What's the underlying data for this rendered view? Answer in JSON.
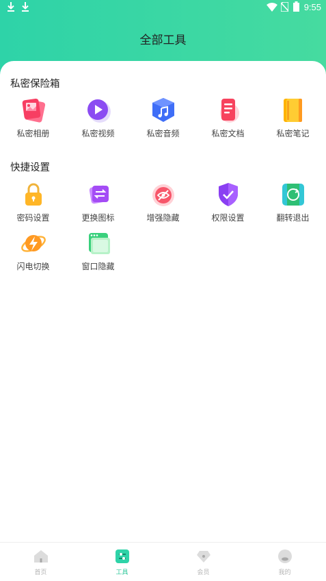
{
  "status_bar": {
    "time": "9:55",
    "icons": [
      "download-icon",
      "download-icon",
      "wifi-icon",
      "no-sim-icon",
      "battery-icon"
    ]
  },
  "header": {
    "title": "全部工具"
  },
  "sections": [
    {
      "title": "私密保险箱",
      "items": [
        {
          "label": "私密相册",
          "icon": "photo-album-icon"
        },
        {
          "label": "私密视频",
          "icon": "video-icon"
        },
        {
          "label": "私密音频",
          "icon": "audio-icon"
        },
        {
          "label": "私密文档",
          "icon": "document-icon"
        },
        {
          "label": "私密笔记",
          "icon": "notebook-icon"
        }
      ]
    },
    {
      "title": "快捷设置",
      "items": [
        {
          "label": "密码设置",
          "icon": "lock-icon"
        },
        {
          "label": "更换图标",
          "icon": "swap-icon"
        },
        {
          "label": "增强隐藏",
          "icon": "hidden-eye-icon"
        },
        {
          "label": "权限设置",
          "icon": "shield-check-icon"
        },
        {
          "label": "翻转退出",
          "icon": "flip-icon"
        },
        {
          "label": "闪电切换",
          "icon": "lightning-icon"
        },
        {
          "label": "窗口隐藏",
          "icon": "window-icon"
        }
      ]
    }
  ],
  "tabbar": {
    "tabs": [
      {
        "label": "首页",
        "icon": "home-icon",
        "active": false
      },
      {
        "label": "工具",
        "icon": "tools-icon",
        "active": true
      },
      {
        "label": "会员",
        "icon": "diamond-icon",
        "active": false
      },
      {
        "label": "我的",
        "icon": "profile-icon",
        "active": false
      }
    ]
  },
  "colors": {
    "accent": "#2ec79a",
    "header_gradient_start": "#2ed3a8",
    "header_gradient_end": "#46dba0"
  }
}
